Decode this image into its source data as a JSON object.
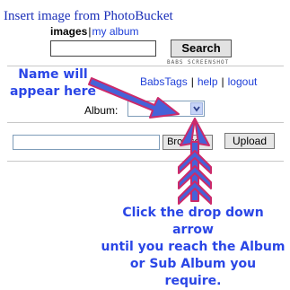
{
  "header": {
    "title": "Insert image from PhotoBucket"
  },
  "tabs": [
    {
      "label": "images",
      "active": true
    },
    {
      "label": "my album",
      "active": false
    }
  ],
  "tab_separator": "|",
  "search": {
    "value": "",
    "button_label": "Search"
  },
  "watermark": "BABS SCREENSHOT",
  "annotations": {
    "name_note_line1": "Name will",
    "name_note_line2": "appear here",
    "dropdown_note_line1": "Click the drop down arrow",
    "dropdown_note_line2": "until you reach the Album",
    "dropdown_note_line3": "or Sub Album you require."
  },
  "account_links": [
    {
      "label": "BabsTags"
    },
    {
      "label": "help"
    },
    {
      "label": "logout"
    }
  ],
  "link_separator": "|",
  "album": {
    "label": "Album:",
    "selected_value": ""
  },
  "upload": {
    "file_value": "",
    "browse_label": "Browse...",
    "upload_label": "Upload"
  },
  "colors": {
    "link": "#1f3fd8",
    "annotation_text": "#2a46e6",
    "arrow_fill": "#4662d8",
    "arrow_outline": "#cc2a6a"
  },
  "icons": {
    "dropdown": "chevron-down-icon"
  }
}
